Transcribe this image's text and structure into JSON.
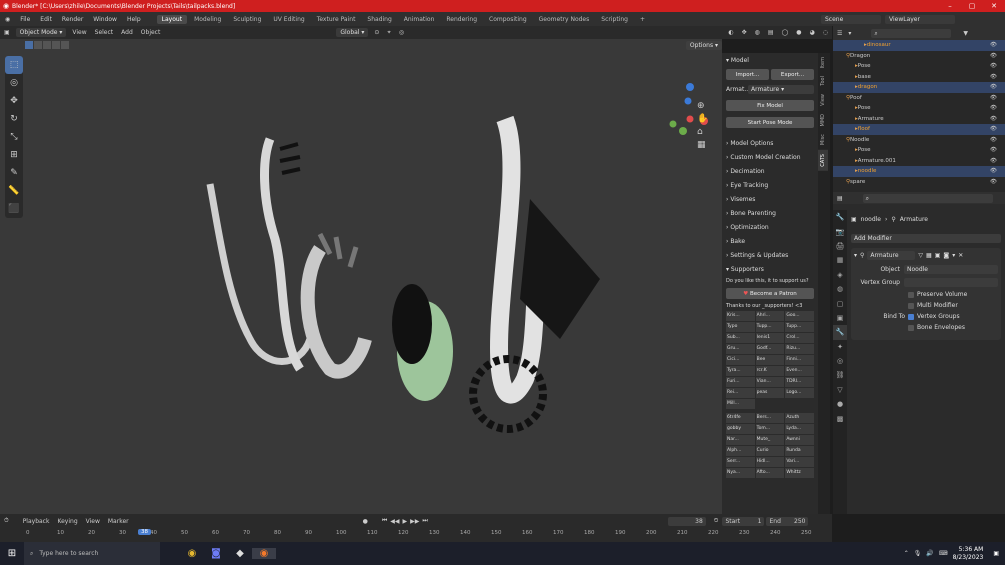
{
  "title": "Blender* [C:\\Users\\zhile\\Documents\\Blender Projects\\Tails\\tailpacks.blend]",
  "menu": [
    "File",
    "Edit",
    "Render",
    "Window",
    "Help"
  ],
  "workspaces": [
    "Layout",
    "Modeling",
    "Sculpting",
    "UV Editing",
    "Texture Paint",
    "Shading",
    "Animation",
    "Rendering",
    "Compositing",
    "Geometry Nodes",
    "Scripting"
  ],
  "scene": "Scene",
  "view_layer": "ViewLayer",
  "header": {
    "mode": "Object Mode",
    "view": "View",
    "select": "Select",
    "add": "Add",
    "object": "Object",
    "transform": "Global",
    "options": "Options"
  },
  "npanel": {
    "model_title": "Model",
    "import": "Import...",
    "export": "Export...",
    "armature_label": "Armat...",
    "armature_value": "Armature",
    "fix_model": "Fix Model",
    "start_pose": "Start Pose Mode",
    "sections": [
      "Model Options",
      "Custom Model Creation",
      "Decimation",
      "Eye Tracking",
      "Visemes",
      "Bone Parenting",
      "Optimization",
      "Bake",
      "Settings & Updates"
    ],
    "supporters_title": "Supporters",
    "support_q": "Do you like this, it to support us?",
    "patron": "Become a Patron",
    "thanks": "Thanks to our _supporters! <3",
    "supporters": [
      "Kris...",
      "Ahri...",
      "Goo...",
      "Typo",
      "Tupp...",
      "Tupp...",
      "Sub...",
      "Ienis1",
      "Crol...",
      "Gru...",
      "Godf...",
      "Rizu...",
      "Cici...",
      "Bee",
      "Finni...",
      "Tyra...",
      "rcr.K",
      "Even...",
      "Furi...",
      "Vian...",
      "TDRI...",
      "Rei...",
      "peas",
      "Logo...",
      "Mill..."
    ],
    "supporters2": [
      "6tr4fe",
      "Bers...",
      "Azuth",
      "gobby",
      "Tom...",
      "Lyda...",
      "Nar...",
      "Mute_",
      "Awnni",
      "Alph...",
      "Curio",
      "Runda",
      "Serr...",
      "Hidl...",
      "Vari...",
      "Nya...",
      "Afto...",
      "Whittz"
    ],
    "tabs": [
      "Item",
      "Tool",
      "View",
      "MMD",
      "Misc",
      "CATS"
    ]
  },
  "outliner": {
    "rows": [
      {
        "label": "dinosaur",
        "indent": 3,
        "sel": true
      },
      {
        "label": "Dragon",
        "indent": 1,
        "sel": false
      },
      {
        "label": "Pose",
        "indent": 2,
        "sel": false
      },
      {
        "label": "base",
        "indent": 2,
        "sel": false
      },
      {
        "label": "dragon",
        "indent": 2,
        "sel": true
      },
      {
        "label": "Poof",
        "indent": 1,
        "sel": false
      },
      {
        "label": "Pose",
        "indent": 2,
        "sel": false
      },
      {
        "label": "Armature",
        "indent": 2,
        "sel": false
      },
      {
        "label": "floof",
        "indent": 2,
        "sel": true
      },
      {
        "label": "Noodle",
        "indent": 1,
        "sel": false
      },
      {
        "label": "Pose",
        "indent": 2,
        "sel": false
      },
      {
        "label": "Armature.001",
        "indent": 2,
        "sel": false
      },
      {
        "label": "noodle",
        "indent": 2,
        "sel": true
      },
      {
        "label": "spare",
        "indent": 1,
        "sel": false
      }
    ]
  },
  "properties": {
    "object": "noodle",
    "data": "Armature",
    "add_modifier": "Add Modifier",
    "modifier_name": "Armature",
    "object_label": "Object",
    "object_value": "Noodle",
    "vgroup_label": "Vertex Group",
    "preserve_volume": "Preserve Volume",
    "multi_modifier": "Multi Modifier",
    "bind_to": "Bind To",
    "vertex_groups": "Vertex Groups",
    "bone_envelopes": "Bone Envelopes"
  },
  "timeline": {
    "playback": "Playback",
    "keying": "Keying",
    "view": "View",
    "marker": "Marker",
    "current": "38",
    "start_label": "Start",
    "start": "1",
    "end_label": "End",
    "end": "250",
    "ticks": [
      "0",
      "10",
      "20",
      "30",
      "40",
      "50",
      "60",
      "70",
      "80",
      "90",
      "100",
      "110",
      "120",
      "130",
      "140",
      "150",
      "160",
      "170",
      "180",
      "190",
      "200",
      "210",
      "220",
      "230",
      "240",
      "250"
    ]
  },
  "taskbar": {
    "search": "Type here to search",
    "time": "5:36 AM",
    "date": "8/23/2023"
  }
}
